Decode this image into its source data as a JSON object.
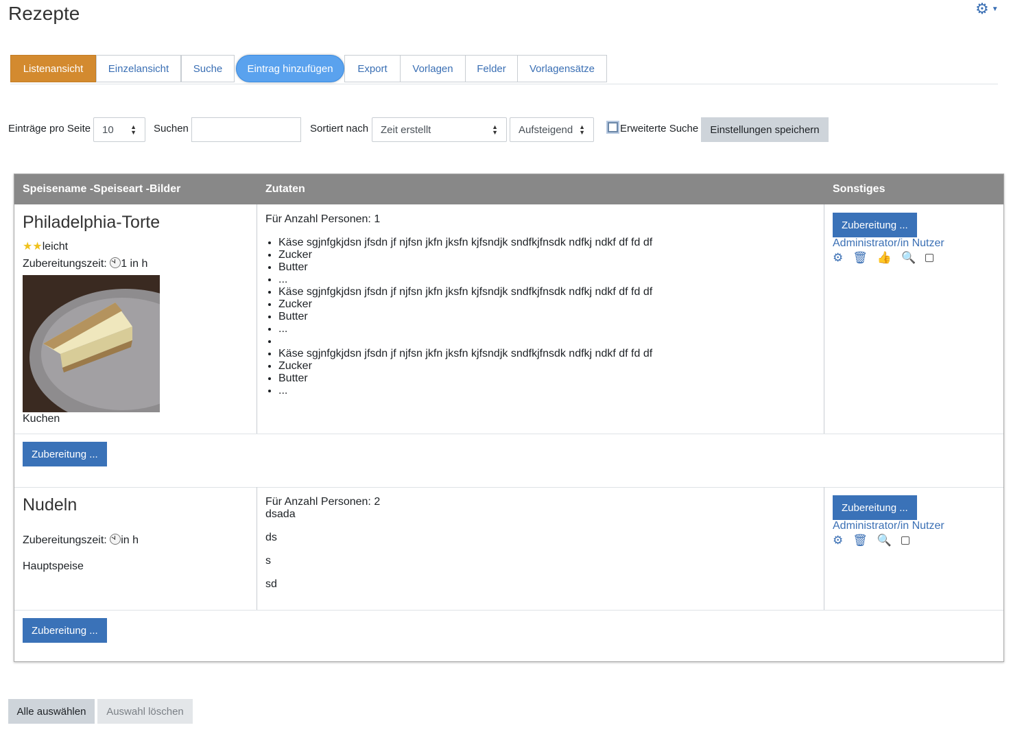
{
  "page": {
    "title": "Rezepte"
  },
  "tabs": [
    {
      "label": "Listenansicht"
    },
    {
      "label": "Einzelansicht"
    },
    {
      "label": "Suche"
    },
    {
      "label": "Eintrag hinzufügen"
    },
    {
      "label": "Export"
    },
    {
      "label": "Vorlagen"
    },
    {
      "label": "Felder"
    },
    {
      "label": "Vorlagensätze"
    }
  ],
  "filters": {
    "per_page_label": "Einträge pro Seite",
    "per_page_value": "10",
    "search_label": "Suchen",
    "search_value": "",
    "sort_label": "Sortiert nach",
    "sort_value": "Zeit erstellt",
    "order_value": "Aufsteigend",
    "advanced_label": "Erweiterte Suche",
    "advanced_checked": false,
    "save_label": "Einstellungen speichern"
  },
  "table": {
    "headers": [
      "Speisename -Speiseart -Bilder",
      "Zutaten",
      "Sonstiges"
    ]
  },
  "entries": [
    {
      "name": "Philadelphia-Torte",
      "difficulty": "leicht",
      "stars": 2,
      "prep_label": "Zubereitungszeit:",
      "prep_value": "1",
      "prep_unit": "in h",
      "category": "Kuchen",
      "persons": "Für Anzahl Personen: 1",
      "ingredients": [
        "Käse sgjnfgkjdsn jfsdn jf njfsn jkfn jksfn kjfsndjk sndfkjfnsdk ndfkj ndkf df fd df",
        "Zucker",
        "Butter",
        "...",
        "Käse sgjnfgkjdsn jfsdn jf njfsn jkfn jksfn kjfsndjk sndfkjfnsdk ndfkj ndkf df fd df",
        "Zucker",
        "Butter",
        "...",
        "",
        "Käse sgjnfgkjdsn jfsdn jf njfsn jkfn jksfn kjfsndjk sndfkjfnsdk ndfkj ndkf df fd df",
        "Zucker",
        "Butter",
        "..."
      ],
      "button": "Zubereitung ...",
      "author": "Administrator/in Nutzer",
      "bottom_button": "Zubereitung ..."
    },
    {
      "name": "Nudeln",
      "prep_label": "Zubereitungszeit:",
      "prep_unit": "in h",
      "category": "Hauptspeise",
      "persons": "Für Anzahl Personen: 2",
      "lines": [
        "dsada",
        "ds",
        "s",
        "sd"
      ],
      "button": "Zubereitung ...",
      "author": "Administrator/in Nutzer",
      "bottom_button": "Zubereitung ..."
    }
  ],
  "footer": {
    "select_all": "Alle auswählen",
    "clear_selection": "Auswahl löschen"
  },
  "colors": {
    "active_tab": "#d38a2f",
    "pill_tab": "#5aa2ee",
    "primary": "#3a72b8",
    "link": "#3a6fb4",
    "table_header": "#888888"
  },
  "icons": [
    "gear-icon",
    "caret-down-icon",
    "star-icon",
    "clock-icon",
    "edit-gear-icon",
    "trash-icon",
    "thumbs-up-icon",
    "zoom-in-icon",
    "sort-arrows-icon"
  ]
}
